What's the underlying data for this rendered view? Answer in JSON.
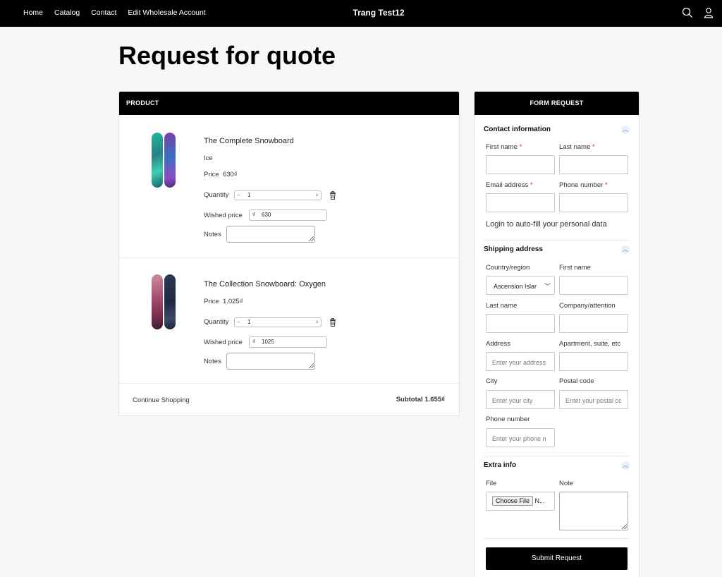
{
  "header": {
    "nav": [
      "Home",
      "Catalog",
      "Contact",
      "Edit Wholesale Account"
    ],
    "brand": "Trang Test12",
    "icons": [
      "search-icon",
      "account-icon"
    ]
  },
  "page": {
    "title": "Request for quote"
  },
  "product_table": {
    "header": "PRODUCT",
    "items": [
      {
        "name": "The Complete Snowboard",
        "variant": "Ice",
        "price_label": "Price",
        "price": "630₫",
        "quantity_label": "Quantity",
        "quantity": "1",
        "wished_price_label": "Wished price",
        "currency": "₫",
        "wished_price": "630",
        "notes_label": "Notes"
      },
      {
        "name": "The Collection Snowboard: Oxygen",
        "price_label": "Price",
        "price": "1.025₫",
        "quantity_label": "Quantity",
        "quantity": "1",
        "wished_price_label": "Wished price",
        "currency": "₫",
        "wished_price": "1025",
        "notes_label": "Notes"
      }
    ],
    "continue_label": "Continue Shopping",
    "subtotal_label": "Subtotal 1.655₫"
  },
  "form": {
    "header": "FORM REQUEST",
    "contact": {
      "title": "Contact information",
      "first_name": "First name",
      "last_name": "Last name",
      "email": "Email address",
      "phone": "Phone number",
      "required_mark": "*",
      "login_text": "Login to auto-fill your personal data"
    },
    "shipping": {
      "title": "Shipping address",
      "country_label": "Country/region",
      "country_value": "Ascension Islar",
      "first_name": "First name",
      "last_name": "Last name",
      "company": "Company/attention",
      "address": "Address",
      "address_placeholder": "Enter your address",
      "apartment": "Apartment, suite, etc",
      "city": "City",
      "city_placeholder": "Enter your city",
      "postal": "Postal code",
      "postal_placeholder": "Enter your postal cc",
      "phone": "Phone number",
      "phone_placeholder": "Enter your phone n"
    },
    "extra": {
      "title": "Extra info",
      "file_label": "File",
      "choose_file": "Choose File",
      "no_file": "N...",
      "note_label": "Note"
    },
    "submit": "Submit Request"
  },
  "colors": {
    "topbar": "#000000",
    "page_bg": "#f7f7f5",
    "required": "#d9232e",
    "chevron": "#4a78c2"
  }
}
